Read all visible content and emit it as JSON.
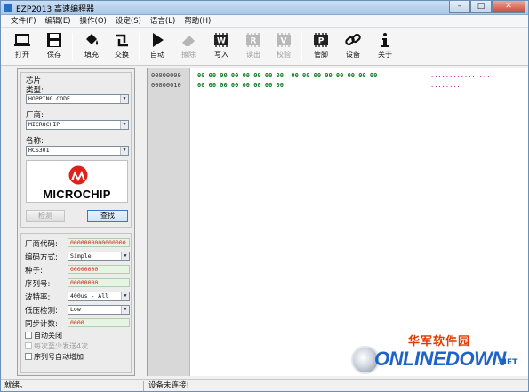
{
  "window": {
    "title": "EZP2013 高速编程器",
    "minimize": "–",
    "maximize": "□",
    "close": "✕"
  },
  "menu": [
    "文件(F)",
    "编辑(E)",
    "操作(O)",
    "设定(S)",
    "语言(L)",
    "帮助(H)"
  ],
  "toolbar": {
    "open": "打开",
    "save": "保存",
    "fill": "填充",
    "swap": "交换",
    "auto": "自动",
    "erase": "擦除",
    "write": "写入",
    "read": "读出",
    "verify": "校验",
    "pin": "管脚",
    "device": "设备",
    "about": "关于",
    "write_glyph": "W",
    "read_glyph": "R",
    "verify_glyph": "V",
    "pin_glyph": "P"
  },
  "chip": {
    "group_title": "芯片",
    "type_label": "类型:",
    "type_value": "HOPPING CODE",
    "vendor_label": "厂商:",
    "vendor_value": "MICROCHIP",
    "name_label": "名称:",
    "name_value": "HCS301",
    "logo_text": "MICROCHIP",
    "detect_button": "检测",
    "search_button": "查找"
  },
  "params": {
    "vendor_code_label": "厂商代码:",
    "vendor_code_value": "0000000000000000",
    "encoding_label": "编码方式:",
    "encoding_value": "Simple",
    "seed_label": "种子:",
    "seed_value": "00000000",
    "serial_label": "序列号:",
    "serial_value": "00000000",
    "baud_label": "波特率:",
    "baud_value": "400us - All",
    "lowvolt_label": "低压检测:",
    "lowvolt_value": "Low",
    "sync_label": "同步计数:",
    "sync_value": "0000",
    "auto_close": "自动关闭",
    "send_min4": "每次至少发送4次",
    "auto_increment": "序列号自动增加"
  },
  "hex": {
    "rows": [
      {
        "addr": "00000000",
        "bytes": "00 00 00 00 00 00 00 00  00 00 00 00 00 00 00 00",
        "ascii": "................"
      },
      {
        "addr": "00000010",
        "bytes": "00 00 00 00 00 00 00 00",
        "ascii": "........"
      }
    ]
  },
  "status": {
    "ready": "就绪。",
    "device": "设备未连接!"
  },
  "watermark": {
    "cn": "华军软件园",
    "en": "ONLINEDOWN",
    "com": ".NET"
  },
  "colors": {
    "accent": "#1e63c9",
    "hex_green": "#0b7a1e",
    "ascii_magenta": "#b0009c",
    "param_red": "#d61f1f"
  }
}
